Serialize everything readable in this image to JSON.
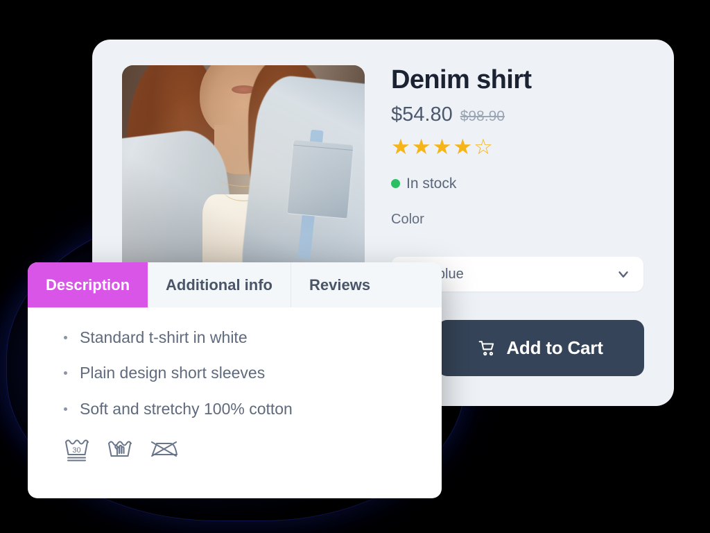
{
  "product": {
    "title": "Denim shirt",
    "price_current": "$54.80",
    "price_original": "$98.90",
    "rating_stars": "★★★★☆",
    "rating_value": 4,
    "rating_max": 5,
    "stock_status": "In stock",
    "stock_color": "#2bbf63",
    "color_label": "Color",
    "color_selected": "Light blue",
    "add_to_cart_label": "Add to Cart",
    "photo_alt": "Woman wearing a light blue denim jacket over a white top"
  },
  "tabs": [
    {
      "label": "Description",
      "active": true
    },
    {
      "label": "Additional info",
      "active": false
    },
    {
      "label": "Reviews",
      "active": false
    }
  ],
  "description": {
    "bullets": [
      "Standard t-shirt in white",
      "Plain design short sleeves",
      "Soft and stretchy 100% cotton"
    ],
    "care_icons": [
      {
        "name": "wash-30-delicate-icon",
        "temperature": "30"
      },
      {
        "name": "hand-wash-icon"
      },
      {
        "name": "do-not-iron-icon"
      }
    ]
  },
  "colors": {
    "accent_magenta": "#d955e8",
    "card_background": "#eef2f6",
    "panel_background": "#ffffff",
    "button_navy": "#354458",
    "star_gold": "#f5b418",
    "text_dark": "#1b2333",
    "text_muted": "#5f6a7d",
    "page_background": "#000000"
  }
}
